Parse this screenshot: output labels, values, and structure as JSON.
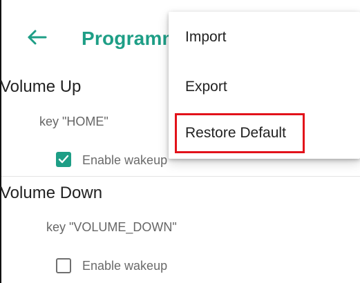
{
  "app_bar": {
    "title": "Programm"
  },
  "menu": {
    "items": [
      {
        "label": "Import"
      },
      {
        "label": "Export"
      },
      {
        "label": "Restore Default"
      }
    ],
    "highlighted_item": "Restore Default"
  },
  "settings": [
    {
      "title": "Volume Up",
      "key_text": "key \"HOME\"",
      "wakeup_label": "Enable wakeup",
      "wakeup_checked": true
    },
    {
      "title": "Volume Down",
      "key_text": "key \"VOLUME_DOWN\"",
      "wakeup_label": "Enable wakeup",
      "wakeup_checked": false
    }
  ],
  "colors": {
    "accent": "#1e9e86",
    "highlight_border": "#e2121a"
  }
}
